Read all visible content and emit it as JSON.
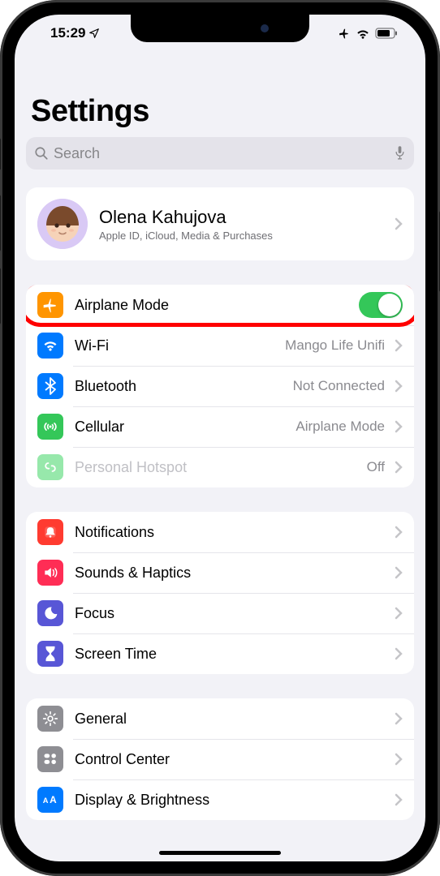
{
  "status": {
    "time": "15:29"
  },
  "title": "Settings",
  "search": {
    "placeholder": "Search"
  },
  "profile": {
    "name": "Olena Kahujova",
    "subtitle": "Apple ID, iCloud, Media & Purchases"
  },
  "connectivity": {
    "airplane": {
      "label": "Airplane Mode",
      "on": true
    },
    "wifi": {
      "label": "Wi-Fi",
      "value": "Mango Life Unifi"
    },
    "bluetooth": {
      "label": "Bluetooth",
      "value": "Not Connected"
    },
    "cellular": {
      "label": "Cellular",
      "value": "Airplane Mode"
    },
    "hotspot": {
      "label": "Personal Hotspot",
      "value": "Off"
    }
  },
  "section2": {
    "notifications": "Notifications",
    "sounds": "Sounds & Haptics",
    "focus": "Focus",
    "screentime": "Screen Time"
  },
  "section3": {
    "general": "General",
    "controlcenter": "Control Center",
    "display": "Display & Brightness"
  }
}
